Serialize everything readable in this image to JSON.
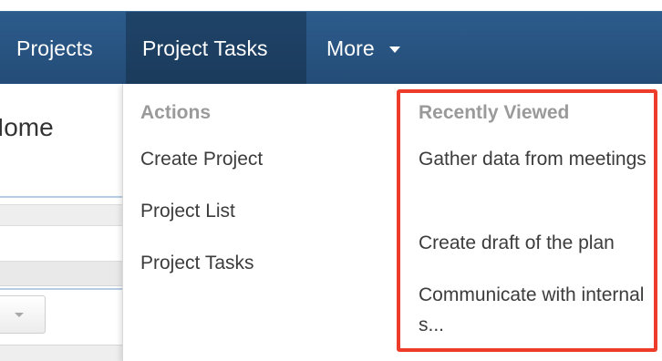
{
  "nav": {
    "projects": "Projects",
    "project_tasks": "Project Tasks",
    "more": "More"
  },
  "background": {
    "page_title": "Home"
  },
  "dropdown": {
    "actions": {
      "heading": "Actions",
      "items": [
        "Create Project",
        "Project List",
        "Project Tasks"
      ]
    },
    "recently_viewed": {
      "heading": "Recently Viewed",
      "items": [
        "Gather data from meetings",
        "Create draft of the plan",
        "Communicate with internal s..."
      ]
    }
  },
  "colors": {
    "nav_background": "#2c5c8c",
    "nav_active": "#1f4368",
    "highlight_border": "#ee3c2a",
    "heading_text": "#9a9a9a"
  },
  "icons": {
    "more_caret": "caret-down-icon",
    "select_caret": "chevron-down-icon"
  }
}
